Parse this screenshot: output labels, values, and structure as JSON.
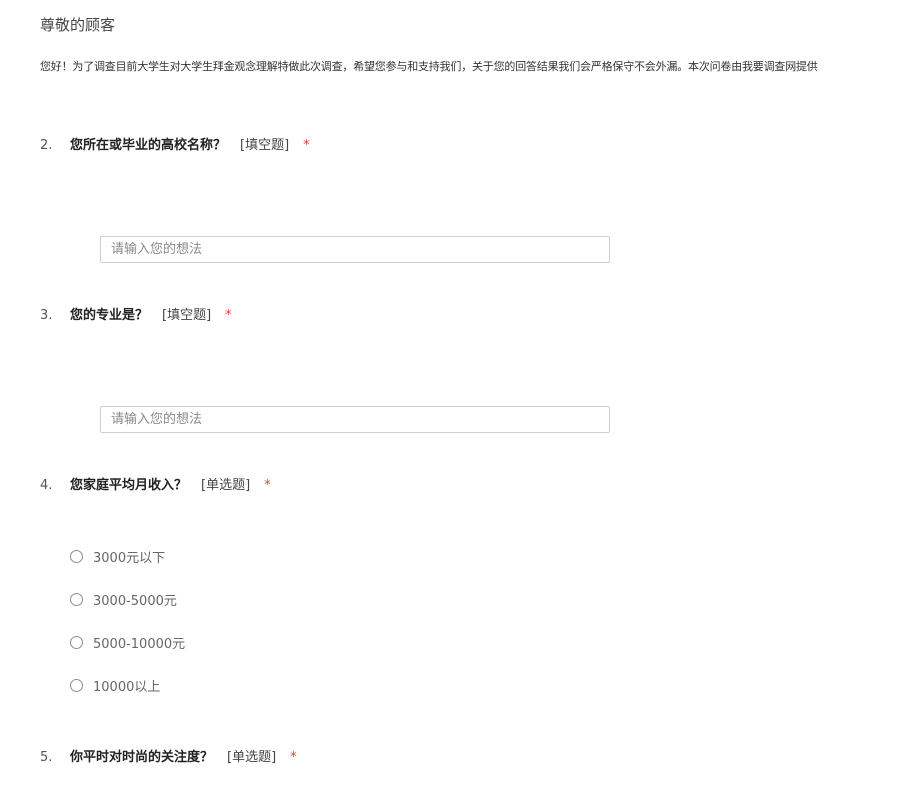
{
  "header": {
    "greeting": "尊敬的顾客",
    "intro": "您好！为了调查目前大学生对大学生拜金观念理解特做此次调查，希望您参与和支持我们，关于您的回答结果我们会严格保守不会外漏。本次问卷由我要调查网提供"
  },
  "questions": [
    {
      "number": "2.",
      "text": "您所在或毕业的高校名称？",
      "type": "[填空题]",
      "required_mark": "*",
      "placeholder": "请输入您的想法"
    },
    {
      "number": "3.",
      "text": "您的专业是？",
      "type": "[填空题]",
      "required_mark": "*",
      "placeholder": "请输入您的想法"
    },
    {
      "number": "4.",
      "text": "您家庭平均月收入？",
      "type": "[单选题]",
      "required_mark": "*",
      "options": [
        "3000元以下",
        "3000-5000元",
        "5000-10000元",
        "10000以上"
      ]
    },
    {
      "number": "5.",
      "text": "你平时对时尚的关注度？",
      "type": "[单选题]",
      "required_mark": "*"
    }
  ],
  "colors": {
    "required": "#e4393c",
    "input_border": "#cfcfcf",
    "radio_border": "#8f8f8f"
  }
}
